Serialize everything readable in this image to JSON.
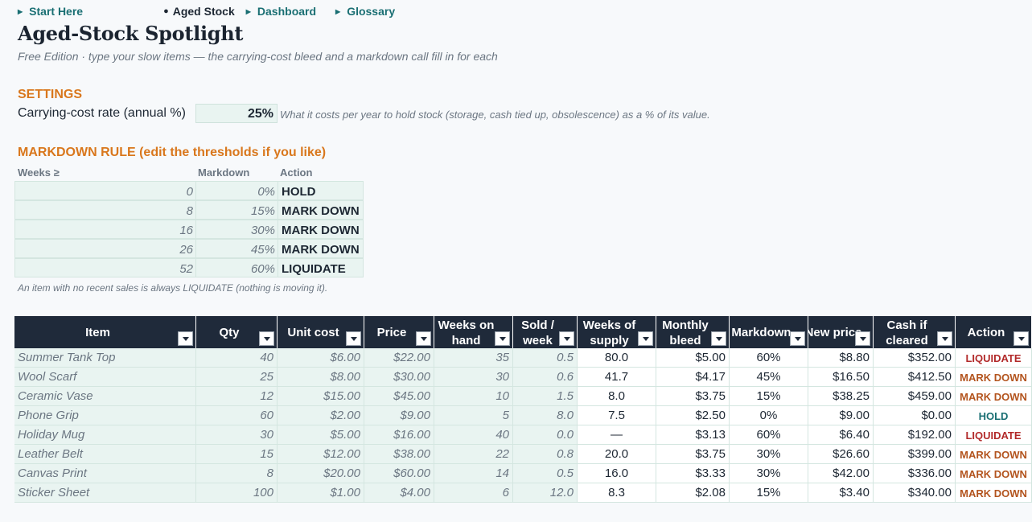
{
  "nav": {
    "start_here": "Start Here",
    "aged_stock": "Aged Stock",
    "dashboard": "Dashboard",
    "glossary": "Glossary"
  },
  "title": "Aged-Stock Spotlight",
  "subtitle": "Free Edition · type your slow items — the carrying-cost bleed and a markdown call fill in for each",
  "settings": {
    "heading": "SETTINGS",
    "carry_label": "Carrying-cost rate (annual %)",
    "carry_value": "25%",
    "carry_note": "What it costs per year to hold stock (storage, cash tied up, obsolescence) as a % of its value."
  },
  "markdown_rule": {
    "heading": "MARKDOWN RULE (edit the thresholds if you like)",
    "headers": {
      "weeks": "Weeks ≥",
      "markdown": "Markdown",
      "action": "Action"
    },
    "rows": [
      {
        "weeks": "0",
        "markdown": "0%",
        "action": "HOLD"
      },
      {
        "weeks": "8",
        "markdown": "15%",
        "action": "MARK DOWN"
      },
      {
        "weeks": "16",
        "markdown": "30%",
        "action": "MARK DOWN"
      },
      {
        "weeks": "26",
        "markdown": "45%",
        "action": "MARK DOWN"
      },
      {
        "weeks": "52",
        "markdown": "60%",
        "action": "LIQUIDATE"
      }
    ],
    "note": "An item with no recent sales is always LIQUIDATE (nothing is moving it)."
  },
  "table": {
    "columns": [
      "Item",
      "Qty",
      "Unit cost",
      "Price",
      "Weeks on hand",
      "Sold / week",
      "Weeks of supply",
      "Monthly bleed",
      "Markdown",
      "New price",
      "Cash if cleared",
      "Action"
    ],
    "rows": [
      [
        "Summer Tank Top",
        "40",
        "$6.00",
        "$22.00",
        "35",
        "0.5",
        "80.0",
        "$5.00",
        "60%",
        "$8.80",
        "$352.00",
        "LIQUIDATE"
      ],
      [
        "Wool Scarf",
        "25",
        "$8.00",
        "$30.00",
        "30",
        "0.6",
        "41.7",
        "$4.17",
        "45%",
        "$16.50",
        "$412.50",
        "MARK DOWN"
      ],
      [
        "Ceramic Vase",
        "12",
        "$15.00",
        "$45.00",
        "10",
        "1.5",
        "8.0",
        "$3.75",
        "15%",
        "$38.25",
        "$459.00",
        "MARK DOWN"
      ],
      [
        "Phone Grip",
        "60",
        "$2.00",
        "$9.00",
        "5",
        "8.0",
        "7.5",
        "$2.50",
        "0%",
        "$9.00",
        "$0.00",
        "HOLD"
      ],
      [
        "Holiday Mug",
        "30",
        "$5.00",
        "$16.00",
        "40",
        "0.0",
        "—",
        "$3.13",
        "60%",
        "$6.40",
        "$192.00",
        "LIQUIDATE"
      ],
      [
        "Leather Belt",
        "15",
        "$12.00",
        "$38.00",
        "22",
        "0.8",
        "20.0",
        "$3.75",
        "30%",
        "$26.60",
        "$399.00",
        "MARK DOWN"
      ],
      [
        "Canvas Print",
        "8",
        "$20.00",
        "$60.00",
        "14",
        "0.5",
        "16.0",
        "$3.33",
        "30%",
        "$42.00",
        "$336.00",
        "MARK DOWN"
      ],
      [
        "Sticker Sheet",
        "100",
        "$1.00",
        "$4.00",
        "6",
        "12.0",
        "8.3",
        "$2.08",
        "15%",
        "$3.40",
        "$340.00",
        "MARK DOWN"
      ]
    ]
  },
  "colors": {
    "accent_orange": "#d9771c",
    "header_navy": "#1f2a3a",
    "input_fill": "#e9f4f1",
    "liquidate": "#b22a2a",
    "mark_down": "#b3541e",
    "hold": "#1a6f73"
  }
}
